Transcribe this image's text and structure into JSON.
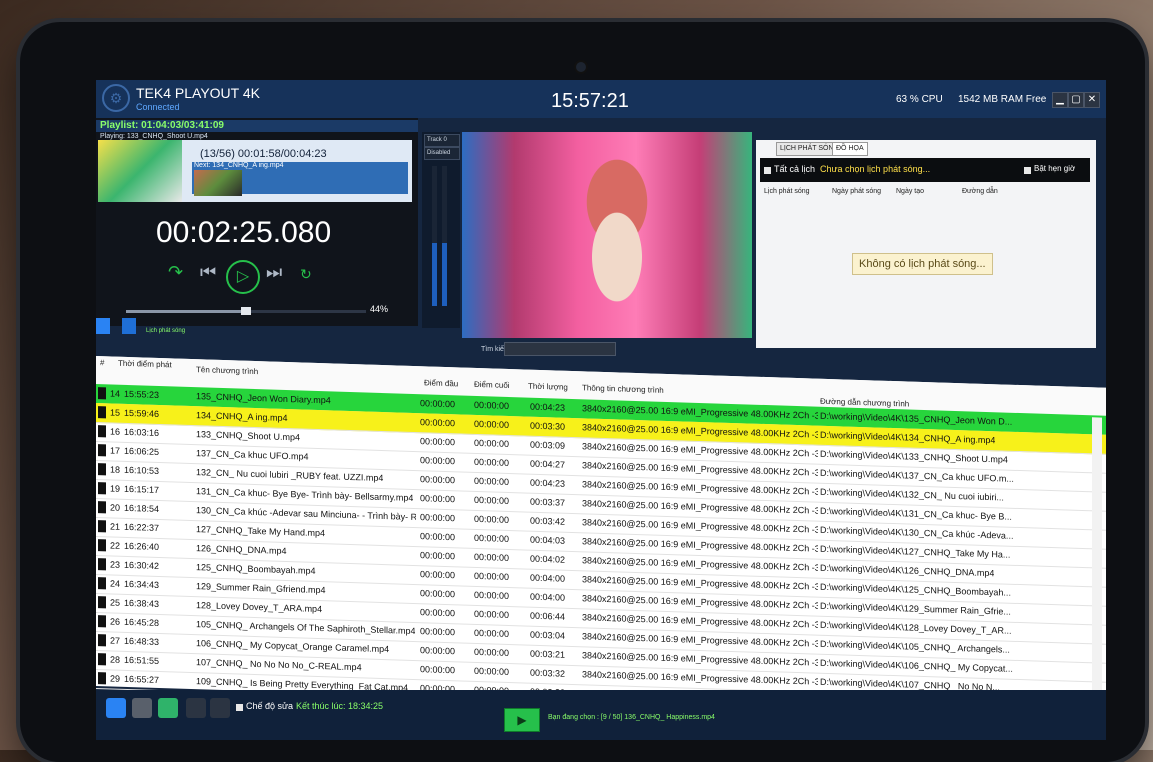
{
  "app": {
    "title": "TEK4 PLAYOUT 4K",
    "status": "Connected",
    "clock": "15:57:21",
    "cpu": "63 % CPU",
    "ram": "1542 MB RAM Free"
  },
  "window_buttons": [
    "▁",
    "▢",
    "✕"
  ],
  "player": {
    "playlist_label": "Playlist: 01:04:03/03:41:09",
    "playing_file": "Playing: 133_CNHQ_Shoot U.mp4",
    "count_time": "(13/56) 00:01:58/00:04:23",
    "next_file": "Next: 134_CNHQ_A ing.mp4",
    "timecode": "00:02:25.080",
    "volume": "44%",
    "progress": 0.5
  },
  "meter": {
    "track_select": "Track 0",
    "mode_select": "Disabled"
  },
  "schedule": {
    "tabs": [
      "LỊCH PHÁT SÓNG",
      "ĐỒ HỌA"
    ],
    "all_label": "Tất cả lịch",
    "message": "Chưa chọn lịch phát sóng...",
    "timer_label": "Bật hẹn giờ",
    "columns": [
      "Lịch phát sóng",
      "Ngày phát sóng",
      "Ngày tạo",
      "Đường dẫn"
    ],
    "empty": "Không có lịch phát sóng..."
  },
  "mid_toolbar": {
    "label": "Lịch phát sóng",
    "search_label": "Tìm kiếm"
  },
  "table": {
    "headers": [
      "#",
      "Thời điểm phát",
      "Tên chương trình",
      "Điểm đầu",
      "Điểm cuối",
      "Thời lượng",
      "Thông tin chương trình",
      "Đường dẫn chương trình"
    ],
    "rows": [
      {
        "n": "14",
        "t": "15:55:23",
        "name": "135_CNHQ_Jeon Won Diary.mp4",
        "in": "00:00:00",
        "out": "00:00:00",
        "dur": "00:04:23",
        "info": "3840x2160@25.00 16:9 eMI_Progressive 48.00KHz 2Ch -32...",
        "path": "D:\\working\\Video\\4K\\135_CNHQ_Jeon Won D...",
        "hl": "green"
      },
      {
        "n": "15",
        "t": "15:59:46",
        "name": "134_CNHQ_A ing.mp4",
        "in": "00:00:00",
        "out": "00:00:00",
        "dur": "00:03:30",
        "info": "3840x2160@25.00 16:9 eMI_Progressive 48.00KHz 2Ch -32...",
        "path": "D:\\working\\Video\\4K\\134_CNHQ_A ing.mp4",
        "hl": "yellow"
      },
      {
        "n": "16",
        "t": "16:03:16",
        "name": "133_CNHQ_Shoot U.mp4",
        "in": "00:00:00",
        "out": "00:00:00",
        "dur": "00:03:09",
        "info": "3840x2160@25.00 16:9 eMI_Progressive 48.00KHz 2Ch -32...",
        "path": "D:\\working\\Video\\4K\\133_CNHQ_Shoot U.mp4",
        "hl": ""
      },
      {
        "n": "17",
        "t": "16:06:25",
        "name": "137_CN_Ca khuc UFO.mp4",
        "in": "00:00:00",
        "out": "00:00:00",
        "dur": "00:04:27",
        "info": "3840x2160@25.00 16:9 eMI_Progressive 48.00KHz 2Ch -32...",
        "path": "D:\\working\\Video\\4K\\137_CN_Ca khuc UFO.m...",
        "hl": ""
      },
      {
        "n": "18",
        "t": "16:10:53",
        "name": "132_CN_ Nu cuoi lubiri _RUBY feat. UZZI.mp4",
        "in": "00:00:00",
        "out": "00:00:00",
        "dur": "00:04:23",
        "info": "3840x2160@25.00 16:9 eMI_Progressive 48.00KHz 2Ch -32...",
        "path": "D:\\working\\Video\\4K\\132_CN_ Nu cuoi iubiri...",
        "hl": ""
      },
      {
        "n": "19",
        "t": "16:15:17",
        "name": "131_CN_Ca khuc- Bye Bye- Trình bày- Bellsarmy.mp4",
        "in": "00:00:00",
        "out": "00:00:00",
        "dur": "00:03:37",
        "info": "3840x2160@25.00 16:9 eMI_Progressive 48.00KHz 2Ch -32...",
        "path": "D:\\working\\Video\\4K\\131_CN_Ca khuc- Bye B...",
        "hl": ""
      },
      {
        "n": "20",
        "t": "16:18:54",
        "name": "130_CN_Ca khúc -Adevar sau Minciuna- - Trình bày- Ruby.m...",
        "in": "00:00:00",
        "out": "00:00:00",
        "dur": "00:03:42",
        "info": "3840x2160@25.00 16:9 eMI_Progressive 48.00KHz 2Ch -32...",
        "path": "D:\\working\\Video\\4K\\130_CN_Ca khúc -Adeva...",
        "hl": ""
      },
      {
        "n": "21",
        "t": "16:22:37",
        "name": "127_CNHQ_Take My Hand.mp4",
        "in": "00:00:00",
        "out": "00:00:00",
        "dur": "00:04:03",
        "info": "3840x2160@25.00 16:9 eMI_Progressive 48.00KHz 2Ch -32...",
        "path": "D:\\working\\Video\\4K\\127_CNHQ_Take My Ha...",
        "hl": ""
      },
      {
        "n": "22",
        "t": "16:26:40",
        "name": "126_CNHQ_DNA.mp4",
        "in": "00:00:00",
        "out": "00:00:00",
        "dur": "00:04:02",
        "info": "3840x2160@25.00 16:9 eMI_Progressive 48.00KHz 2Ch -32...",
        "path": "D:\\working\\Video\\4K\\126_CNHQ_DNA.mp4",
        "hl": ""
      },
      {
        "n": "23",
        "t": "16:30:42",
        "name": "125_CNHQ_Boombayah.mp4",
        "in": "00:00:00",
        "out": "00:00:00",
        "dur": "00:04:00",
        "info": "3840x2160@25.00 16:9 eMI_Progressive 48.00KHz 2Ch -32...",
        "path": "D:\\working\\Video\\4K\\125_CNHQ_Boombayah...",
        "hl": ""
      },
      {
        "n": "24",
        "t": "16:34:43",
        "name": "129_Summer Rain_Gfriend.mp4",
        "in": "00:00:00",
        "out": "00:00:00",
        "dur": "00:04:00",
        "info": "3840x2160@25.00 16:9 eMI_Progressive 48.00KHz 2Ch -32...",
        "path": "D:\\working\\Video\\4K\\129_Summer Rain_Gfrie...",
        "hl": ""
      },
      {
        "n": "25",
        "t": "16:38:43",
        "name": "128_Lovey Dovey_T_ARA.mp4",
        "in": "00:00:00",
        "out": "00:00:00",
        "dur": "00:06:44",
        "info": "3840x2160@25.00 16:9 eMI_Progressive 48.00KHz 2Ch -32...",
        "path": "D:\\working\\Video\\4K\\128_Lovey Dovey_T_AR...",
        "hl": ""
      },
      {
        "n": "26",
        "t": "16:45:28",
        "name": "105_CNHQ_ Archangels Of The Saphiroth_Stellar.mp4",
        "in": "00:00:00",
        "out": "00:00:00",
        "dur": "00:03:04",
        "info": "3840x2160@25.00 16:9 eMI_Progressive 48.00KHz 2Ch -32...",
        "path": "D:\\working\\Video\\4K\\105_CNHQ_ Archangels...",
        "hl": ""
      },
      {
        "n": "27",
        "t": "16:48:33",
        "name": "106_CNHQ_ My Copycat_Orange Caramel.mp4",
        "in": "00:00:00",
        "out": "00:00:00",
        "dur": "00:03:21",
        "info": "3840x2160@25.00 16:9 eMI_Progressive 48.00KHz 2Ch -32...",
        "path": "D:\\working\\Video\\4K\\106_CNHQ_ My Copycat...",
        "hl": ""
      },
      {
        "n": "28",
        "t": "16:51:55",
        "name": "107_CNHQ_ No No No No_C-REAL.mp4",
        "in": "00:00:00",
        "out": "00:00:00",
        "dur": "00:03:32",
        "info": "3840x2160@25.00 16:9 eMI_Progressive 48.00KHz 2Ch -32...",
        "path": "D:\\working\\Video\\4K\\107_CNHQ_ No No N...",
        "hl": ""
      },
      {
        "n": "29",
        "t": "16:55:27",
        "name": "109_CNHQ_ Is Being Pretty Everything_Fat Cat.mp4",
        "in": "00:00:00",
        "out": "00:00:00",
        "dur": "00:03:38",
        "info": "3840x2160@25.00 16:9 eMI_Progressive 48.00KHz 2Ch -32...",
        "path": "D:\\working\\Video\\4K\\109_CNHQ_ Is Being Pr...",
        "hl": ""
      }
    ]
  },
  "bottom": {
    "edit_mode": "Chế độ sửa",
    "end_time": "Kết thúc lúc: 18:34:25",
    "now_selected": "Bạn đang chọn : [9 / 50] 136_CNHQ_ Happiness.mp4"
  },
  "colors": {
    "title_bar": "#16325a",
    "accent_green": "#26c04b",
    "highlight_green": "#27d53c",
    "highlight_yellow": "#f7f11a"
  }
}
